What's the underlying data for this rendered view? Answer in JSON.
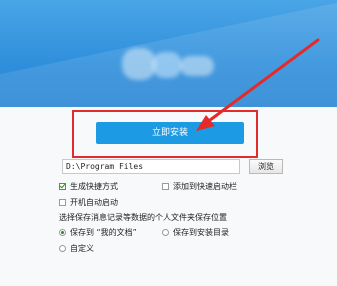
{
  "installer": {
    "install_button": "立即安装",
    "install_path": "D:\\Program Files",
    "browse_button": "浏览",
    "options": {
      "create_shortcut": {
        "label": "生成快捷方式",
        "checked": true
      },
      "add_quick_launch": {
        "label": "添加到快速启动栏",
        "checked": false
      },
      "autostart": {
        "label": "开机自动启动",
        "checked": false
      }
    },
    "save_location_caption": "选择保存消息记录等数据的个人文件夹保存位置",
    "save_choices": {
      "my_documents": {
        "label": "保存到 “我的文档”",
        "checked": true
      },
      "install_dir": {
        "label": "保存到安装目录",
        "checked": false
      },
      "custom": {
        "label": "自定义",
        "checked": false
      }
    }
  },
  "colors": {
    "banner": "#2f8fdc",
    "install_button": "#1d9ae4",
    "highlight": "#e32b2b",
    "arrow": "#e32b2b"
  }
}
